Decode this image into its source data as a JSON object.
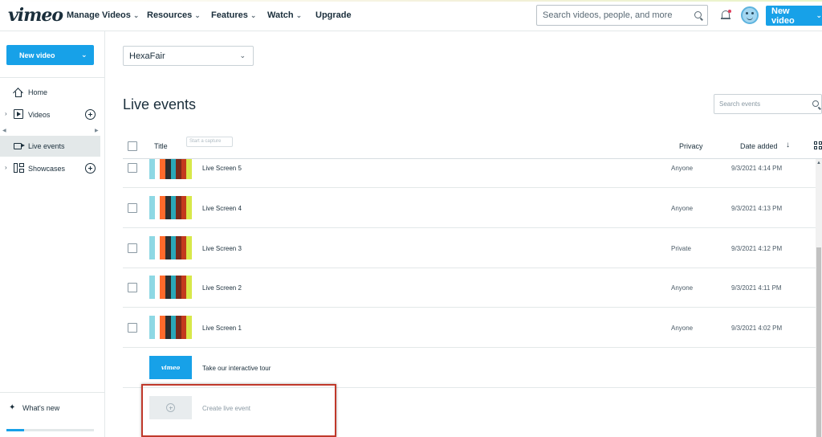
{
  "colors": {
    "accent": "#17a1e8",
    "highlight": "#c0392b",
    "text": "#1a2e3b"
  },
  "topbar": {
    "logo": "vimeo",
    "nav": [
      {
        "label": "Manage Videos",
        "has_chevron": true
      },
      {
        "label": "Resources",
        "has_chevron": true
      },
      {
        "label": "Features",
        "has_chevron": true
      },
      {
        "label": "Watch",
        "has_chevron": true
      },
      {
        "label": "Upgrade",
        "has_chevron": false
      }
    ],
    "search_placeholder": "Search videos, people, and more",
    "new_video_label": "New video",
    "icons": [
      "search-icon",
      "bell-icon",
      "avatar",
      "chevron-down-icon"
    ]
  },
  "sidebar": {
    "new_video_label": "New video",
    "items": [
      {
        "label": "Home",
        "icon": "home-icon"
      },
      {
        "label": "Videos",
        "icon": "videos-icon"
      },
      {
        "label": "Live events",
        "icon": "camera-icon"
      },
      {
        "label": "Showcases",
        "icon": "showcase-icon"
      }
    ],
    "whats_new": "What's new",
    "storage_fraction": 0.2
  },
  "main": {
    "team_name": "HexaFair",
    "page_title": "Live events",
    "search_placeholder": "Search events",
    "columns": {
      "title": "Title",
      "capture_tip": "Start a capture",
      "privacy": "Privacy",
      "date_added": "Date added"
    },
    "rows": [
      {
        "title": "Live Screen 5",
        "privacy": "Anyone",
        "date": "9/3/2021 4:14 PM"
      },
      {
        "title": "Live Screen 4",
        "privacy": "Anyone",
        "date": "9/3/2021 4:13 PM"
      },
      {
        "title": "Live Screen 3",
        "privacy": "Private",
        "date": "9/3/2021 4:12 PM"
      },
      {
        "title": "Live Screen 2",
        "privacy": "Anyone",
        "date": "9/3/2021 4:11 PM"
      },
      {
        "title": "Live Screen 1",
        "privacy": "Anyone",
        "date": "9/3/2021 4:02 PM"
      }
    ],
    "thumb_colors": [
      "#8ed8e4",
      "#ffffff",
      "#ff6a2b",
      "#2d2d2d",
      "#2aa7b8",
      "#7a2a1a",
      "#c33a1d",
      "#d8e84a"
    ],
    "tour": {
      "label": "Take our interactive tour",
      "thumb_text": "vimeo"
    },
    "create": {
      "label": "Create live event"
    }
  }
}
